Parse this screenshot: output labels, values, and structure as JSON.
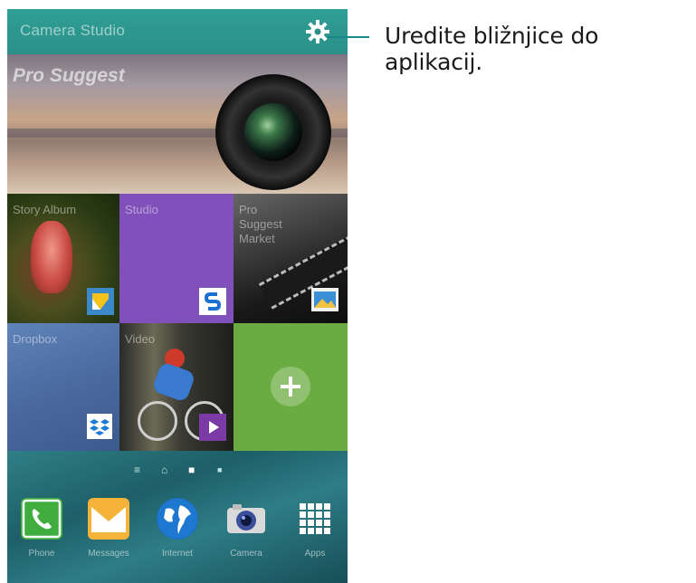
{
  "header": {
    "title": "Camera Studio"
  },
  "callout": {
    "text": "Uredite bližnjice do aplikacij."
  },
  "tiles": {
    "pro_suggest": "Pro Suggest",
    "story_album": "Story Album",
    "studio": "Studio",
    "pro_suggest_market": "Pro Suggest Market",
    "dropbox": "Dropbox",
    "video": "Video"
  },
  "dock": [
    {
      "label": "Phone",
      "icon": "phone-icon"
    },
    {
      "label": "Messages",
      "icon": "messages-icon"
    },
    {
      "label": "Internet",
      "icon": "internet-icon"
    },
    {
      "label": "Camera",
      "icon": "camera-icon"
    },
    {
      "label": "Apps",
      "icon": "apps-grid-icon"
    }
  ],
  "colors": {
    "header": "#2b8f88",
    "studio": "#8050bb",
    "add_tile": "#6aac41",
    "callout_line": "#15888a"
  }
}
